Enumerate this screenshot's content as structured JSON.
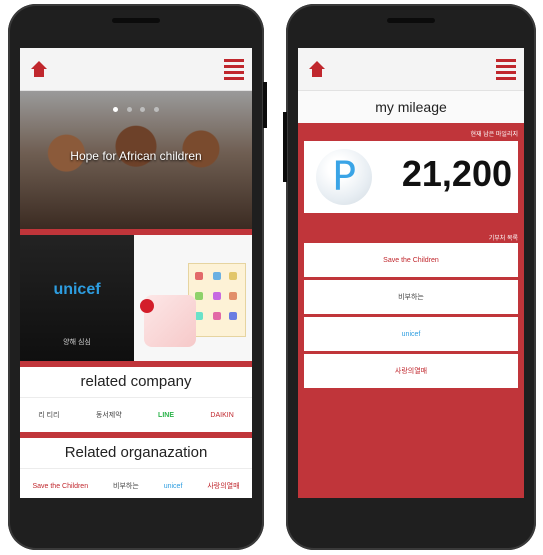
{
  "left": {
    "hero_title": "Hope for African children",
    "carousel_dots": 4,
    "promo": {
      "unicef_logo": "unicef",
      "unicef_caption": "양해 심심"
    },
    "related_company_title": "related company",
    "companies": [
      "리 티리",
      "동서제약",
      "LINE",
      "DAIKIN"
    ],
    "related_org_title": "Related organazation",
    "organizations": [
      "Save the Children",
      "비부하는",
      "unicef",
      "사랑의열매"
    ]
  },
  "right": {
    "mileage_title": "my mileage",
    "points_caption": "현재 남은 마일리지",
    "points_value": "21,200",
    "points_icon_letter": "P",
    "list_caption": "기부처 목록",
    "organizations": [
      "Save the Children",
      "비부하는",
      "unicef",
      "사랑의열매"
    ]
  },
  "colors": {
    "brand_red": "#c0353a",
    "phone_body": "#1f1f1f",
    "unicef_blue": "#2d9de0",
    "line_green": "#2bb34a"
  },
  "icons": {
    "home": "home-icon",
    "menu": "menu-icon",
    "points": "points-icon"
  }
}
